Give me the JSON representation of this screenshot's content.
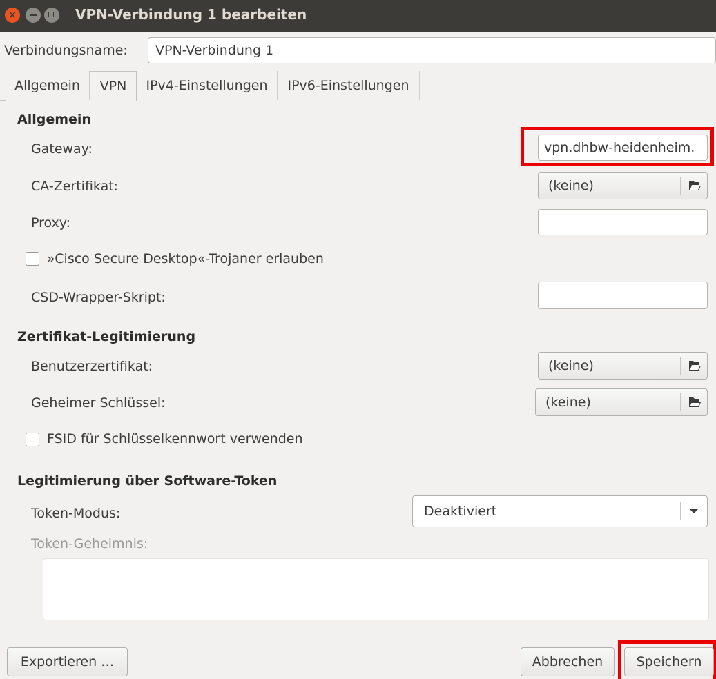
{
  "window": {
    "title": "VPN-Verbindung 1 bearbeiten",
    "close_glyph": "×"
  },
  "connection": {
    "name_label": "Verbindungsname:",
    "name_value": "VPN-Verbindung 1"
  },
  "tabs": [
    {
      "label": "Allgemein",
      "active": false
    },
    {
      "label": "VPN",
      "active": true
    },
    {
      "label": "IPv4-Einstellungen",
      "active": false
    },
    {
      "label": "IPv6-Einstellungen",
      "active": false
    }
  ],
  "sections": {
    "general": {
      "title": "Allgemein",
      "gateway_label": "Gateway:",
      "gateway_value": "vpn.dhbw-heidenheim.",
      "ca_label": "CA-Zertifikat:",
      "ca_value": "(keine)",
      "proxy_label": "Proxy:",
      "proxy_value": "",
      "cisco_label": "»Cisco Secure Desktop«-Trojaner erlauben",
      "cisco_checked": false,
      "csd_label": "CSD-Wrapper-Skript:",
      "csd_value": ""
    },
    "cert_auth": {
      "title": "Zertifikat-Legitimierung",
      "user_cert_label": "Benutzerzertifikat:",
      "user_cert_value": "(keine)",
      "private_key_label": "Geheimer Schlüssel:",
      "private_key_value": "(keine)",
      "fsid_label": "FSID für Schlüsselkennwort verwenden",
      "fsid_checked": false
    },
    "software_token": {
      "title": "Legitimierung über Software-Token",
      "mode_label": "Token-Modus:",
      "mode_value": "Deaktiviert",
      "secret_label": "Token-Geheimnis:",
      "secret_value": ""
    }
  },
  "buttons": {
    "export": "Exportieren …",
    "cancel": "Abbrechen",
    "save": "Speichern"
  },
  "colors": {
    "highlight": "#ea0000",
    "titlebar": "#3c3b37",
    "close_button": "#e95420"
  },
  "icons": {
    "file_chooser": "document-open-icon",
    "dropdown": "chevron-down-icon"
  }
}
